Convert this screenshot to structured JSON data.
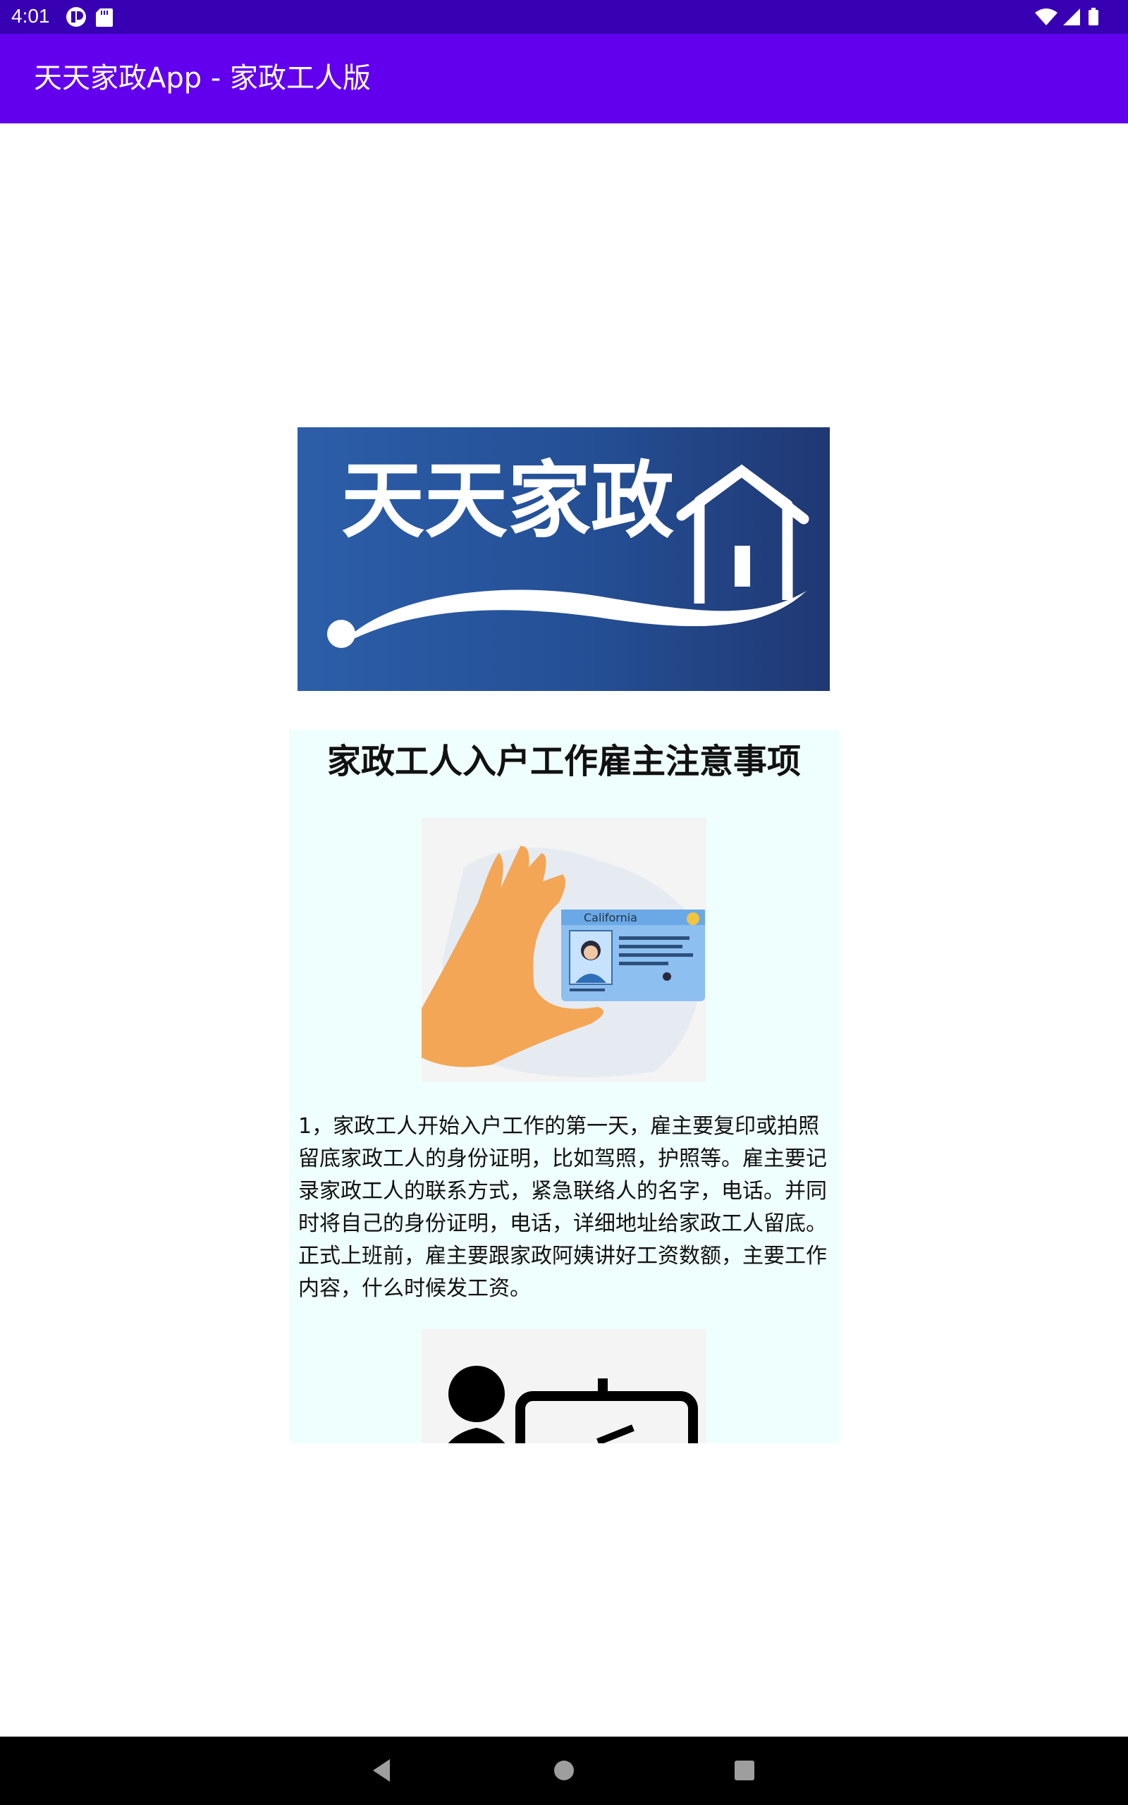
{
  "status_bar": {
    "time": "4:01",
    "left_icons": [
      "app-notification-icon",
      "sd-card-icon"
    ],
    "right_icons": [
      "wifi-icon",
      "cell-signal-icon",
      "battery-icon"
    ]
  },
  "app_bar": {
    "title": "天天家政App - 家政工人版",
    "color": "#6200ee"
  },
  "banner": {
    "logo_text": "天天家政",
    "icon": "house-icon"
  },
  "article": {
    "title": "家政工人入户工作雇主注意事项",
    "image1_icon": "id-card-hand-illustration",
    "image1_caption": "California",
    "paragraph1": "1，家政工人开始入户工作的第一天，雇主要复印或拍照留底家政工人的身份证明，比如驾照，护照等。雇主要记录家政工人的联系方式，紧急联络人的名字，电话。并同时将自己的身份证明，电话，详细地址给家政工人留底。正式上班前，雇主要跟家政阿姨讲好工资数额，主要工作内容，什么时候发工资。",
    "image2_icon": "employer-presentation-illustration"
  },
  "nav_bar": {
    "buttons": [
      "back-icon",
      "home-icon",
      "recents-icon"
    ]
  }
}
